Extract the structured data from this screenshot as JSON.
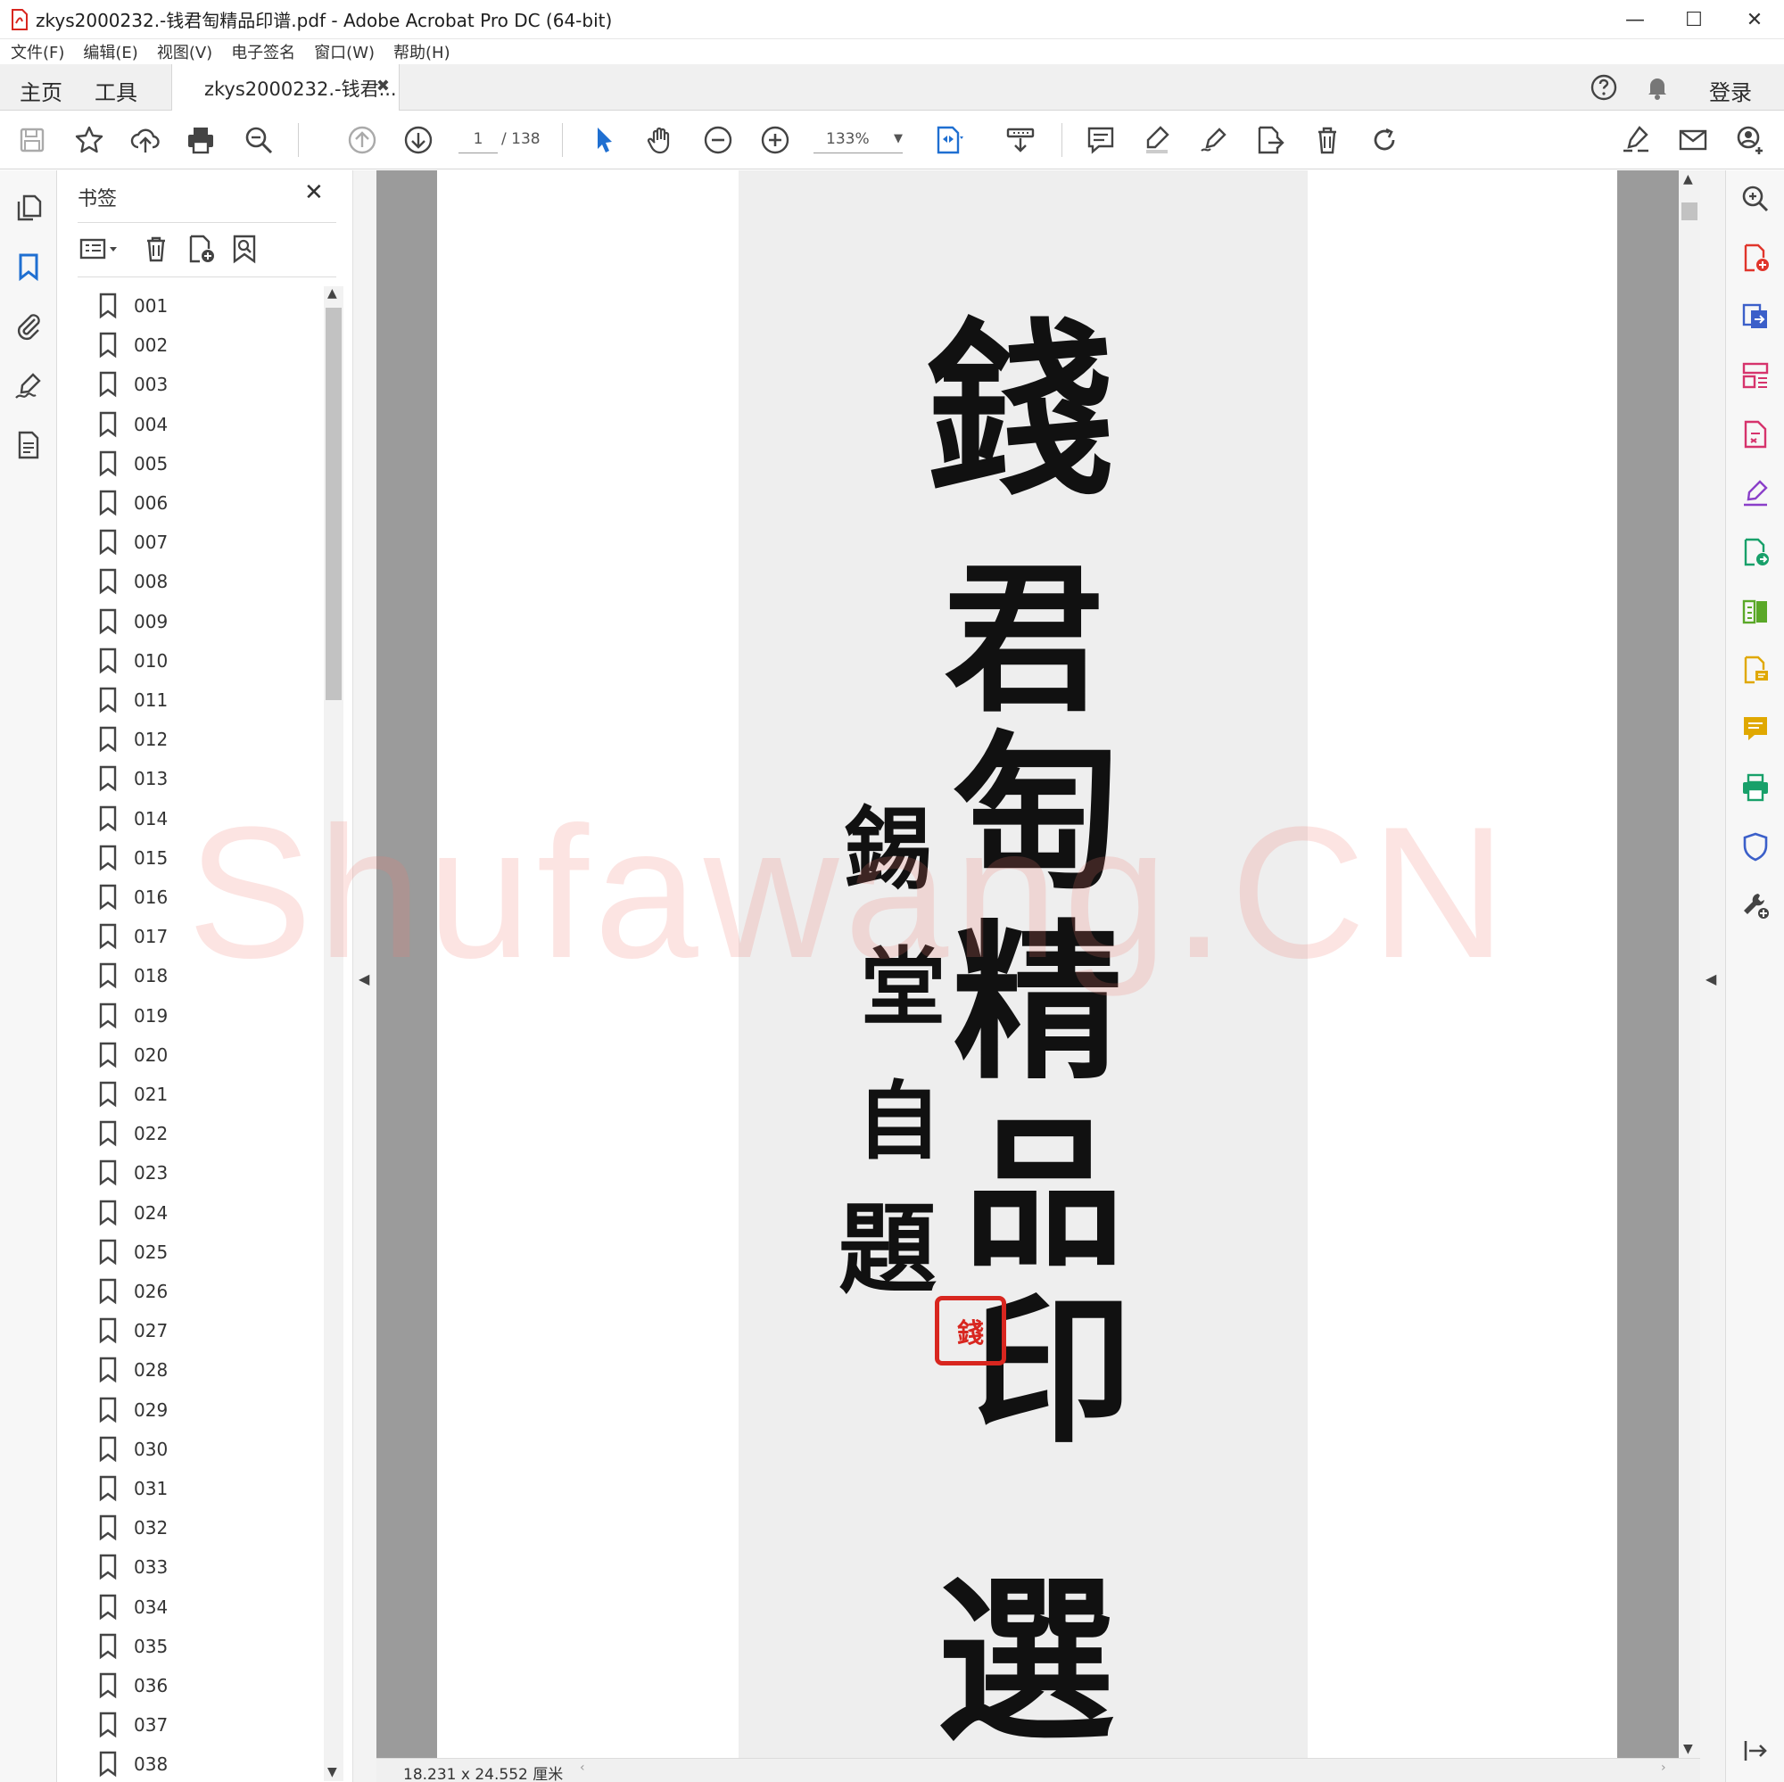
{
  "window": {
    "title": "zkys2000232.-钱君匋精品印谱.pdf - Adobe Acrobat Pro DC (64-bit)",
    "minimize": "—",
    "maximize": "☐",
    "close": "✕"
  },
  "menu": [
    "文件(F)",
    "编辑(E)",
    "视图(V)",
    "电子签名",
    "窗口(W)",
    "帮助(H)"
  ],
  "tabs": {
    "home": "主页",
    "tools": "工具",
    "document": "zkys2000232.-钱君...",
    "close": "✖",
    "login": "登录"
  },
  "toolbar": {
    "page_current": "1",
    "page_total": "/ 138",
    "zoom": "133%",
    "zoom_caret": "▼"
  },
  "bookmarks": {
    "title": "书签",
    "close": "✕",
    "items": [
      "001",
      "002",
      "003",
      "004",
      "005",
      "006",
      "007",
      "008",
      "009",
      "010",
      "011",
      "012",
      "013",
      "014",
      "015",
      "016",
      "017",
      "018",
      "019",
      "020",
      "021",
      "022",
      "023",
      "024",
      "025",
      "026",
      "027",
      "028",
      "029",
      "030",
      "031",
      "032",
      "033",
      "034",
      "035",
      "036",
      "037",
      "038"
    ]
  },
  "document": {
    "title_chars": [
      "錢",
      "君",
      "匋",
      "精",
      "品",
      "印",
      "選"
    ],
    "inscription_chars": [
      "錫",
      "堂",
      "自",
      "題"
    ],
    "seal_text": "錢",
    "watermark": "Shufawang.CN"
  },
  "status": {
    "page_size": "18.231 x 24.552 厘米"
  },
  "colors": {
    "accent_blue": "#1f6fd1",
    "seal_red": "#d8261f",
    "watermark": "#f0786e"
  },
  "icons": {
    "left_strip": [
      "page-thumbnails-icon",
      "bookmark-icon",
      "attachment-icon",
      "signature-icon",
      "document-icon"
    ],
    "right_panel": [
      "zoom-search-icon",
      "create-pdf-icon",
      "export-pdf-icon",
      "organize-pages-icon",
      "edit-pdf-icon",
      "fill-sign-icon",
      "send-review-icon",
      "compare-icon",
      "comment-file-icon",
      "comment-icon",
      "print-production-icon",
      "protect-icon",
      "more-tools-icon",
      "expand-panel-icon"
    ]
  }
}
